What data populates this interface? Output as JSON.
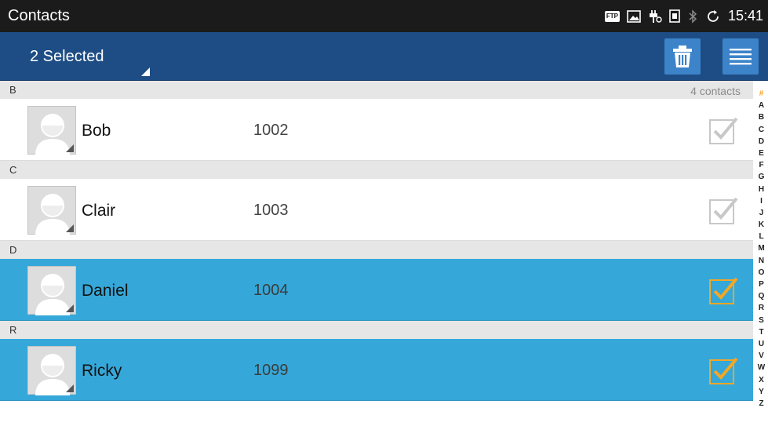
{
  "status_bar": {
    "title": "Contacts",
    "icons": [
      "ftp-icon",
      "image-icon",
      "usb-icon",
      "sim-icon",
      "bluetooth-icon",
      "sync-icon"
    ],
    "ftp_label": "FTP",
    "time": "15:41"
  },
  "action_bar": {
    "selected_label": "2 Selected",
    "delete_icon": "trash-icon",
    "menu_icon": "menu-icon"
  },
  "contacts_count": "4 contacts",
  "sections": [
    {
      "letter": "B",
      "contacts": [
        {
          "name": "Bob",
          "number": "1002",
          "selected": false
        }
      ]
    },
    {
      "letter": "C",
      "contacts": [
        {
          "name": "Clair",
          "number": "1003",
          "selected": false
        }
      ]
    },
    {
      "letter": "D",
      "contacts": [
        {
          "name": "Daniel",
          "number": "1004",
          "selected": true
        }
      ]
    },
    {
      "letter": "R",
      "contacts": [
        {
          "name": "Ricky",
          "number": "1099",
          "selected": true
        }
      ]
    }
  ],
  "alphabet_index": [
    "#",
    "A",
    "B",
    "C",
    "D",
    "E",
    "F",
    "G",
    "H",
    "I",
    "J",
    "K",
    "L",
    "M",
    "N",
    "O",
    "P",
    "Q",
    "R",
    "S",
    "T",
    "U",
    "V",
    "W",
    "X",
    "Y",
    "Z"
  ],
  "colors": {
    "status_bar": "#1b1b1b",
    "action_bar": "#1e4d85",
    "button": "#3c83c9",
    "selected_row": "#35a8d9",
    "check_selected": "#f5a623",
    "check_unselected": "#c8c8c8"
  }
}
